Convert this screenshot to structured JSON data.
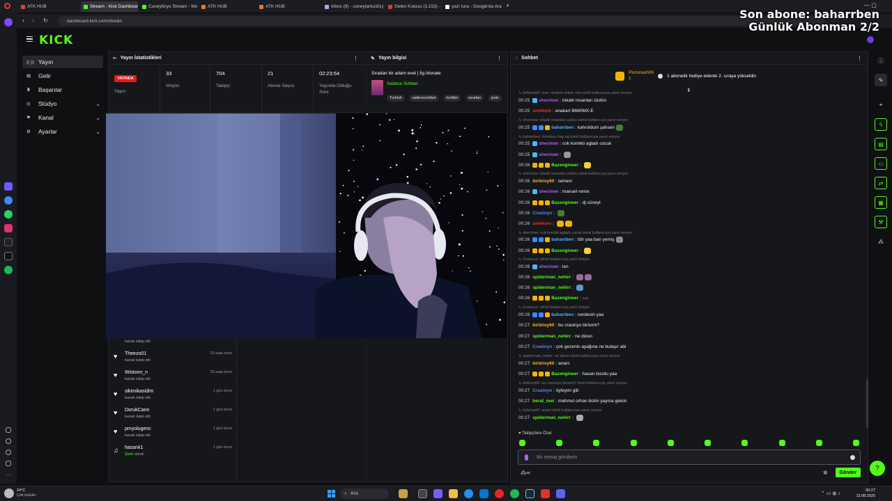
{
  "browser": {
    "tabs": [
      {
        "label": "ATK HUB",
        "color": "#e24040"
      },
      {
        "label": "Stream - Kick Dashboard",
        "color": "#53fc18",
        "active": true
      },
      {
        "label": "Cuneytinyo Stream - Web",
        "color": "#53fc18"
      },
      {
        "label": "ATK HUB",
        "color": "#e27a30"
      },
      {
        "label": "ATK HUB",
        "color": "#e27a30"
      },
      {
        "label": "Inbox (8) - cuneytartuc81@",
        "color": "#c8a0e0"
      },
      {
        "label": "Gelen Kutusu (3.153) - cu",
        "color": "#d04040"
      },
      {
        "label": "yazı tura - Google'da Ara",
        "color": "#ffffff"
      }
    ],
    "url": "dashboard.kick.com/stream"
  },
  "overlay": {
    "line1": "Son abone: baharrben",
    "line2": "Günlük Abonman 2/2"
  },
  "brand": {
    "logo": "KICK",
    "accent": "#53fc18"
  },
  "nav": {
    "items": [
      {
        "label": "Yayın",
        "icon": "broadcast-icon",
        "active": true
      },
      {
        "label": "Gelir",
        "icon": "dollar-icon"
      },
      {
        "label": "Başarılar",
        "icon": "trophy-icon"
      },
      {
        "label": "Stüdyo",
        "icon": "studio-icon",
        "chevron": true
      },
      {
        "label": "Kanal",
        "icon": "user-icon",
        "chevron": true
      },
      {
        "label": "Ayarlar",
        "icon": "gear-icon",
        "chevron": true
      }
    ]
  },
  "stats": {
    "title": "Yayın İstatistikleri",
    "live_badge": "YAYINDA",
    "live_label": "Yayın",
    "items": [
      {
        "value": "33",
        "label": "İzleyici"
      },
      {
        "value": "704",
        "label": "Takipçi"
      },
      {
        "value": "21",
        "label": "Abone Sayısı"
      },
      {
        "value": "02:23:54",
        "label": "Yayında Olduğu Süre"
      }
    ]
  },
  "info": {
    "title": "Yayın bilgisi",
    "stream_title": "Sıradan bir adam evet | İig İdonate",
    "category": "Sadece Sohbet",
    "tags": [
      "Turkish",
      "sadecesohbet",
      "özelbiri",
      "sıradan",
      "justc"
    ]
  },
  "followers": {
    "partial": "kanalı takip etti",
    "items": [
      {
        "name": "Theezo01",
        "action": "kanalı takip etti",
        "time": "23 saat önce"
      },
      {
        "name": "Wistonn_n",
        "action": "kanalı takip etti",
        "time": "23 saat önce"
      },
      {
        "name": "sikimikasidim",
        "action": "kanalı takip etti",
        "time": "1 gün önce"
      },
      {
        "name": "DorukCann",
        "action": "kanalı takip etti",
        "time": "1 gün önce"
      },
      {
        "name": "pmyolugenc",
        "action": "kanalı takip etti",
        "time": "1 gün önce"
      },
      {
        "name": "hasank1",
        "action": "alındı",
        "action_prefix": "Şarkı",
        "time": "1 gün önce"
      }
    ]
  },
  "chat": {
    "title": "Sohbet",
    "pinned_user": "Plutonash06",
    "pinned_count": "1",
    "pinned_text": "1 abonelik hediye ederek 2. sıraya yükseldin",
    "messages": [
      {
        "reply": "birbirey60: ever random erkek oha isimli kullanıcıya yanıt veriyor"
      },
      {
        "time": "00:25",
        "user": "shechow",
        "color": "#b05cff",
        "text": "tokatlı insanları üzdün"
      },
      {
        "time": "00:25",
        "user": "unlekom",
        "color": "#e23535",
        "text": "anakart B660MX-E"
      },
      {
        "reply": "shechow: tokatlı insanları üzdün isimli kullanıcıya yanıt veriyor"
      },
      {
        "time": "00:25",
        "user": "baharrben",
        "color": "#4db6ff",
        "text": "kahroldum şahsen"
      },
      {
        "reply": "baharrben: bomboş olay aq isimli kullanıcıya yanıt veriyor"
      },
      {
        "time": "00:25",
        "user": "shechow",
        "color": "#b05cff",
        "text": "cok komikti agladı cocuk"
      },
      {
        "time": "00:25",
        "user": "shechow",
        "color": "#b05cff",
        "text": ""
      },
      {
        "time": "00:26",
        "user": "Bazengineer",
        "color": "#53fc18",
        "text": ""
      },
      {
        "reply": "shechow: tokatlı insanları üzdün isimli kullanıcıya yanıt veriyor"
      },
      {
        "time": "00:26",
        "user": "birbirey60",
        "color": "#ffb02e",
        "text": "tamam"
      },
      {
        "time": "00:26",
        "user": "shechow",
        "color": "#b05cff",
        "text": "manuel remix"
      },
      {
        "time": "00:26",
        "user": "Bazengineer",
        "color": "#53fc18",
        "text": "dj cüneyt"
      },
      {
        "time": "00:26",
        "user": "Crasinyo",
        "color": "#4d8bff",
        "text": ""
      },
      {
        "time": "00:26",
        "user": "unlekom",
        "color": "#e23535",
        "text": ""
      },
      {
        "reply": "shechow: cok komikti agladı cocuk isimli kullanıcıya yanıt veriyor"
      },
      {
        "time": "00:26",
        "user": "baharrben",
        "color": "#4db6ff",
        "text": "tüh yaa ban yemiş"
      },
      {
        "time": "00:26",
        "user": "Bazengineer",
        "color": "#53fc18",
        "text": ""
      },
      {
        "reply": "Crasinyo: isimli kullanıcıya yanıt veriyor"
      },
      {
        "time": "00:26",
        "user": "shechow",
        "color": "#b05cff",
        "text": "len"
      },
      {
        "time": "00:26",
        "user": "spiderman_nehirr",
        "color": "#53fc18",
        "text": ""
      },
      {
        "time": "00:26",
        "user": "spiderman_nehirr",
        "color": "#53fc18",
        "text": ""
      },
      {
        "time": "00:26",
        "user": "Bazengineer",
        "color": "#53fc18",
        "text": "sus"
      },
      {
        "reply": "Crasinyo: isimli kullanıcıya yanıt veriyor"
      },
      {
        "time": "00:26",
        "user": "baharrben",
        "color": "#4db6ff",
        "text": "nerdesin yaa"
      },
      {
        "time": "00:27",
        "user": "birbirey60",
        "color": "#ffb02e",
        "text": "bu crasinyo birisimi?"
      },
      {
        "time": "00:27",
        "user": "spiderman_nehirr",
        "color": "#53fc18",
        "text": "ne diooo"
      },
      {
        "time": "00:27",
        "user": "Crasinyo",
        "color": "#4d8bff",
        "text": "çok gezenin ayağına ne bulaşır abi"
      },
      {
        "reply": "spiderman_nehirr: ne diooo isimli kullanıcıya yanıt veriyor"
      },
      {
        "time": "00:27",
        "user": "birbirey60",
        "color": "#ffb02e",
        "text": "anani"
      },
      {
        "time": "00:27",
        "user": "Bazengineer",
        "color": "#53fc18",
        "text": "hasan bozdu yaa"
      },
      {
        "reply": "birbirey60: bu crasinyo birisimi? isimli kullanıcıya yanıt veriyor"
      },
      {
        "time": "00:27",
        "user": "Crasinyo",
        "color": "#4d8bff",
        "text": "öyleyim gib"
      },
      {
        "time": "00:27",
        "user": "berat_mei",
        "color": "#53fc18",
        "text": "mahmut orhan bizim yayına gelsin"
      },
      {
        "reply": "birbirey60: anani isimli kullanıcıya yanıt veriyor"
      },
      {
        "time": "00:27",
        "user": "spiderman_nehirr",
        "color": "#53fc18",
        "text": ""
      }
    ],
    "followers_only": "Takipçilere Özel",
    "input_placeholder": "Bir mesaj gönderin",
    "send_label": "Gönder"
  },
  "taskbar": {
    "weather_temp": "24°C",
    "weather_text": "Çok bulutlu",
    "search_placeholder": "Ara",
    "clock_time": "00:27",
    "clock_date": "12.08.2025"
  }
}
